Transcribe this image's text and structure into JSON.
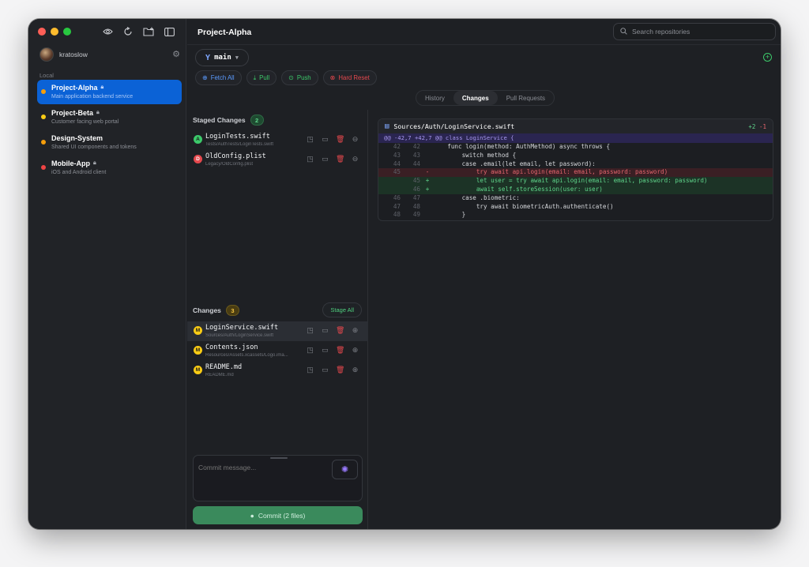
{
  "sidebar": {
    "username": "kratoslow",
    "section_label": "Local",
    "repos": [
      {
        "name": "Project-Alpha",
        "desc": "Main application backend service",
        "color": "#f59e0b",
        "locked": true
      },
      {
        "name": "Project-Beta",
        "desc": "Customer facing web portal",
        "color": "#facc15",
        "locked": true
      },
      {
        "name": "Design-System",
        "desc": "Shared UI components and tokens",
        "color": "#f59e0b",
        "locked": false
      },
      {
        "name": "Mobile-App",
        "desc": "iOS and Android client",
        "color": "#ef4444",
        "locked": true
      }
    ]
  },
  "header": {
    "title": "Project-Alpha",
    "search_placeholder": "Search repositories"
  },
  "branch": "main",
  "actions": [
    {
      "label": "Fetch All",
      "color": "#5b9bff",
      "icon": "fetch-icon"
    },
    {
      "label": "Pull",
      "color": "#3cc96a",
      "icon": "pull-icon"
    },
    {
      "label": "Push",
      "color": "#3cc96a",
      "icon": "push-icon"
    },
    {
      "label": "Hard Reset",
      "color": "#e5484d",
      "icon": "reset-icon"
    }
  ],
  "tabs": [
    "History",
    "Changes",
    "Pull Requests"
  ],
  "active_tab": "Changes",
  "staged": {
    "label": "Staged Changes",
    "count": "2",
    "files": [
      {
        "badge": "A",
        "badge_color": "#3cc96a",
        "name": "LoginTests.swift",
        "path": "Tests/AuthTests/LoginTests.swift"
      },
      {
        "badge": "D",
        "badge_color": "#e5484d",
        "name": "OldConfig.plist",
        "path": "Legacy/OldConfig.plist"
      }
    ]
  },
  "changes": {
    "label": "Changes",
    "count": "3",
    "stage_all": "Stage All",
    "files": [
      {
        "badge": "M",
        "badge_color": "#facc15",
        "name": "LoginService.swift",
        "path": "Sources/Auth/LoginService.swift"
      },
      {
        "badge": "M",
        "badge_color": "#facc15",
        "name": "Contents.json",
        "path": "Resources/Assets.xcassets/Logo.ima..."
      },
      {
        "badge": "M",
        "badge_color": "#facc15",
        "name": "README.md",
        "path": "README.md"
      }
    ]
  },
  "commit": {
    "placeholder": "Commit message...",
    "button": "Commit (2 files)"
  },
  "diff": {
    "file": "Sources/Auth/LoginService.swift",
    "added": "+2",
    "removed": "-1",
    "hunk": "@@ -42,7 +42,7 @@ class LoginService {",
    "lines": [
      {
        "o": "42",
        "n": "42",
        "t": "ctx",
        "code": "    func login(method: AuthMethod) async throws {"
      },
      {
        "o": "43",
        "n": "43",
        "t": "ctx",
        "code": "        switch method {"
      },
      {
        "o": "44",
        "n": "44",
        "t": "ctx",
        "code": "        case .email(let email, let password):"
      },
      {
        "o": "45",
        "n": "",
        "t": "del",
        "code": "            try await api.login(email: email, password: password)"
      },
      {
        "o": "",
        "n": "45",
        "t": "add",
        "code": "            let user = try await api.login(email: email, password: password)"
      },
      {
        "o": "",
        "n": "46",
        "t": "add",
        "code": "            await self.storeSession(user: user)"
      },
      {
        "o": "46",
        "n": "47",
        "t": "ctx",
        "code": "        case .biometric:"
      },
      {
        "o": "47",
        "n": "48",
        "t": "ctx",
        "code": "            try await biometricAuth.authenticate()"
      },
      {
        "o": "48",
        "n": "49",
        "t": "ctx",
        "code": "        }"
      }
    ]
  }
}
